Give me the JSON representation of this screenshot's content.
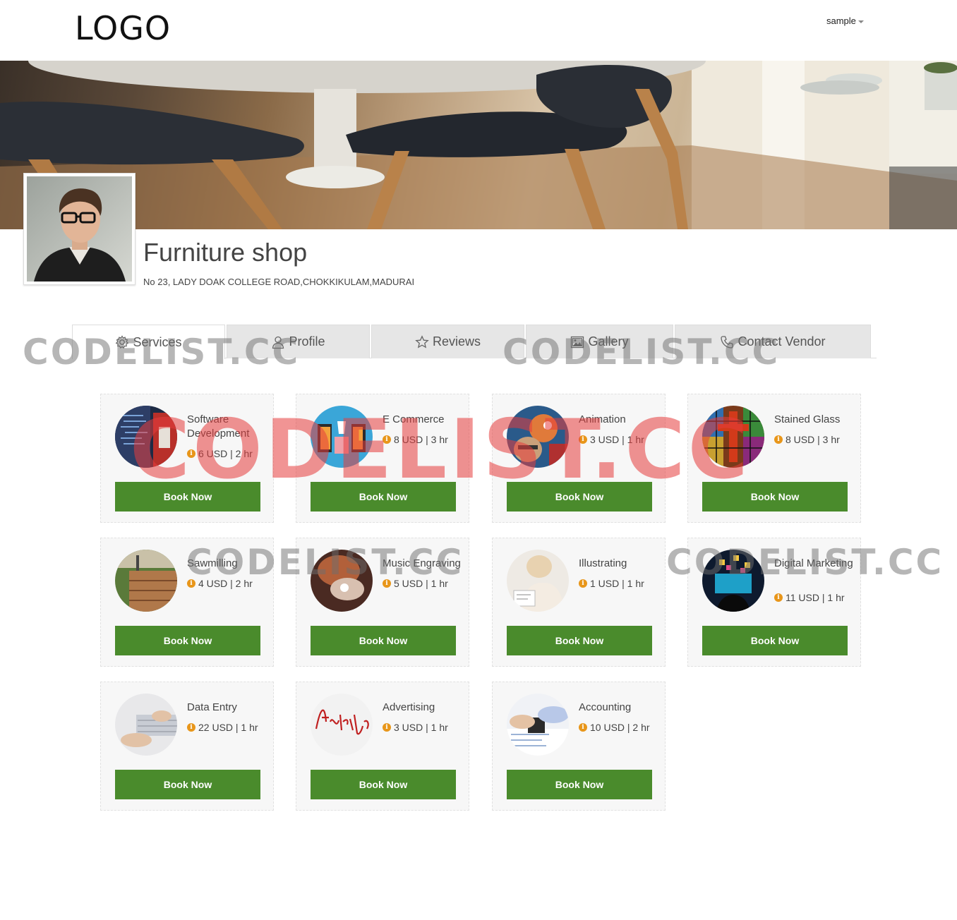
{
  "header": {
    "logo": "LOGO",
    "user": "sample"
  },
  "profile": {
    "name": "Furniture shop",
    "address": "No 23, LADY DOAK COLLEGE ROAD,CHOKKIKULAM,MADURAI"
  },
  "tabs": [
    {
      "label": "Services",
      "icon": "gear-icon",
      "active": true
    },
    {
      "label": "Profile",
      "icon": "user-icon",
      "active": false
    },
    {
      "label": "Reviews",
      "icon": "star-icon",
      "active": false
    },
    {
      "label": "Gallery",
      "icon": "image-icon",
      "active": false
    },
    {
      "label": "Contact Vendor",
      "icon": "phone-icon",
      "active": false
    }
  ],
  "services": [
    {
      "title": "Software Development",
      "price": "6 USD | 2 hr",
      "button": "Book Now"
    },
    {
      "title": "E Commerce",
      "price": "8 USD | 3 hr",
      "button": "Book Now"
    },
    {
      "title": "Animation",
      "price": "3 USD | 1 hr",
      "button": "Book Now"
    },
    {
      "title": "Stained Glass",
      "price": "8 USD | 3 hr",
      "button": "Book Now"
    },
    {
      "title": "Sawmilling",
      "price": "4 USD | 2 hr",
      "button": "Book Now"
    },
    {
      "title": "Music Engraving",
      "price": "5 USD | 1 hr",
      "button": "Book Now"
    },
    {
      "title": "Illustrating",
      "price": "1 USD | 1 hr",
      "button": "Book Now"
    },
    {
      "title": "Digital Marketing",
      "price": "11 USD | 1 hr",
      "button": "Book Now"
    },
    {
      "title": "Data Entry",
      "price": "22 USD | 1 hr",
      "button": "Book Now"
    },
    {
      "title": "Advertising",
      "price": "3 USD | 1 hr",
      "button": "Book Now"
    },
    {
      "title": "Accounting",
      "price": "10 USD | 2 hr",
      "button": "Book Now"
    }
  ],
  "watermarks": {
    "small": "CODELIST.CC",
    "big": "CODELIST.CC"
  },
  "colors": {
    "book_button": "#4a8b2c",
    "info_icon": "#e8961a",
    "tab_inactive": "#e6e6e6"
  }
}
